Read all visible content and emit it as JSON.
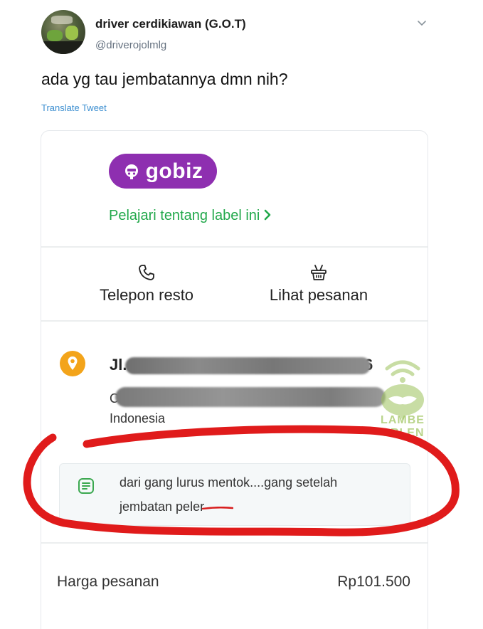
{
  "tweet": {
    "display_name": "driver cerdikiawan (G.O.T)",
    "handle": "@driverojolmlg",
    "text": "ada yg tau jembatannya dmn nih?",
    "translate_label": "Translate Tweet",
    "menu_icon": "chevron-down-icon"
  },
  "card": {
    "badge_label": "gobiz",
    "badge_color": "#8e2fb0",
    "learn_link": "Pelajari tentang label ini",
    "learn_link_color": "#22a84b",
    "actions": [
      {
        "label": "Telepon resto",
        "icon": "phone-icon"
      },
      {
        "label": "Lihat pesanan",
        "icon": "basket-icon"
      }
    ],
    "address": {
      "line1_prefix": "Jl. ",
      "line1_end": "6",
      "line2_prefix": "C",
      "line3": "Indonesia",
      "pin_color": "#f3a41a"
    },
    "note": {
      "line1": "dari gang lurus mentok....gang setelah",
      "line2": "jembatan peler"
    },
    "price": {
      "label": "Harga pesanan",
      "value": "Rp101.500"
    },
    "watermark": {
      "line1": "LAMBE",
      "line2": "ORLEN"
    },
    "annotation_color": "#e01b1b"
  }
}
